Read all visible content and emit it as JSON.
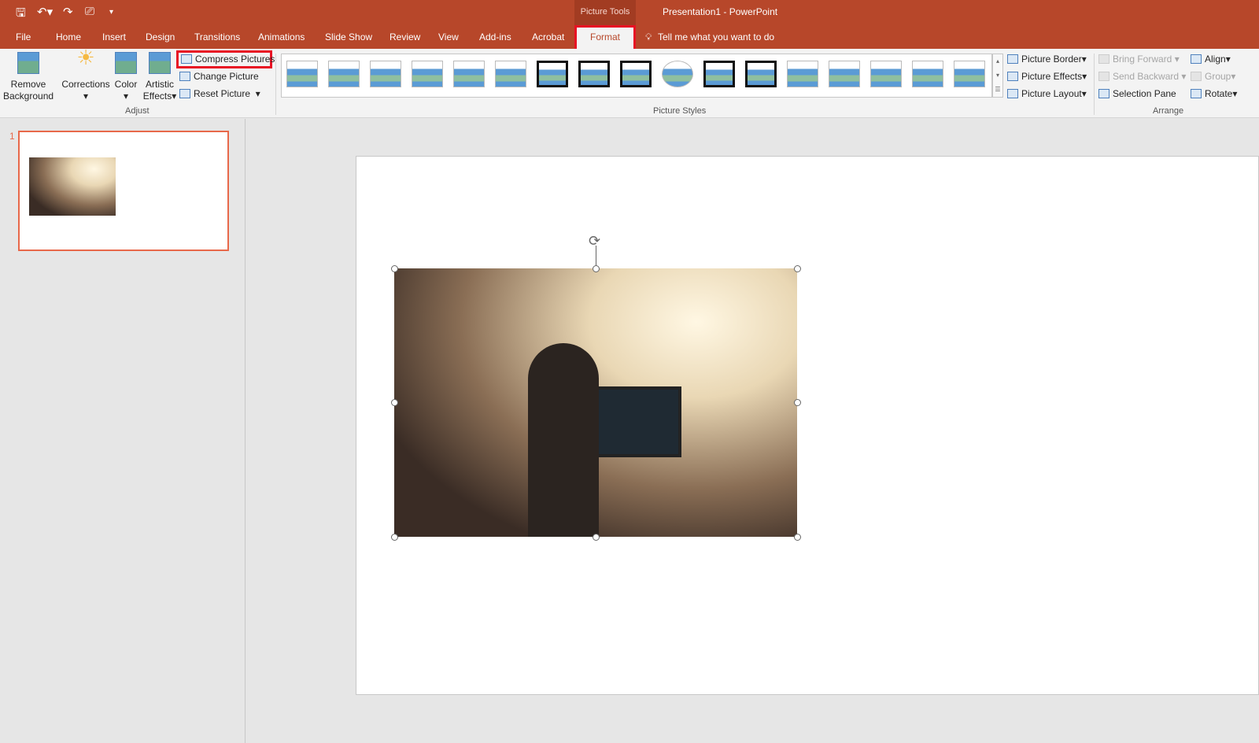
{
  "qat": {
    "icons": [
      "save-icon",
      "undo-icon",
      "redo-icon",
      "start-from-beginning-icon",
      "customize-icon"
    ]
  },
  "title": {
    "context": "Picture Tools",
    "window": "Presentation1 - PowerPoint"
  },
  "tabs": [
    "File",
    "Home",
    "Insert",
    "Design",
    "Transitions",
    "Animations",
    "Slide Show",
    "Review",
    "View",
    "Add-ins",
    "Acrobat",
    "Format"
  ],
  "tell_me": "Tell me what you want to do",
  "adjust": {
    "remove_background": [
      "Remove",
      "Background"
    ],
    "corrections": "Corrections",
    "color": "Color",
    "artistic": [
      "Artistic",
      "Effects"
    ],
    "compress": "Compress Pictures",
    "change": "Change Picture",
    "reset": "Reset Picture",
    "group": "Adjust"
  },
  "styles": {
    "group": "Picture Styles",
    "border": "Picture Border",
    "effects": "Picture Effects",
    "layout": "Picture Layout"
  },
  "arrange": {
    "forward": "Bring Forward",
    "backward": "Send Backward",
    "selection": "Selection Pane",
    "align": "Align",
    "group_btn": "Group",
    "rotate": "Rotate",
    "group": "Arrange"
  },
  "slides": {
    "number": "1"
  },
  "colors": {
    "accent": "#b7472a",
    "highlight": "#e81123"
  }
}
